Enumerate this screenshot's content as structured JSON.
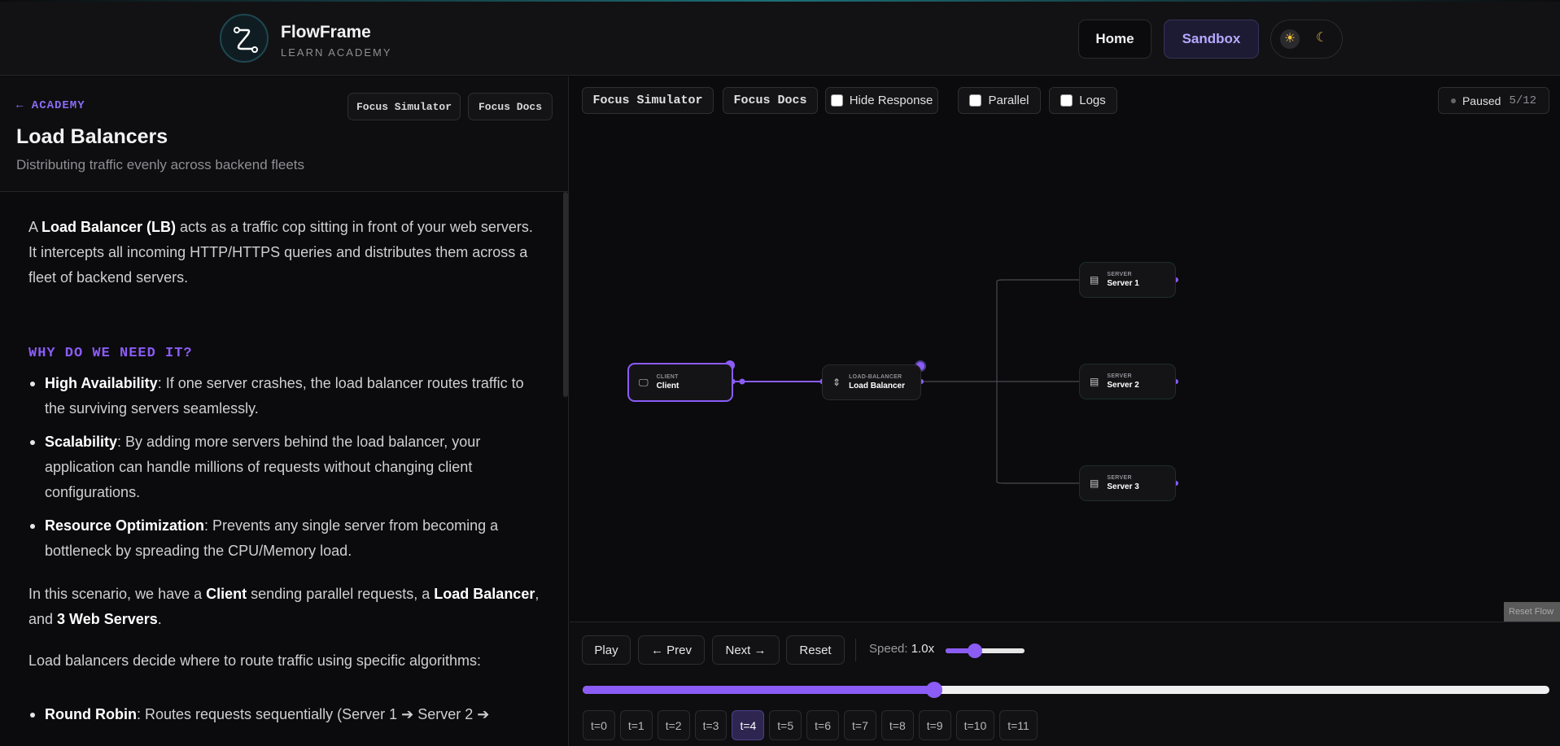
{
  "app": {
    "name": "FlowFrame",
    "tagline": "LEARN ACADEMY"
  },
  "nav": {
    "home": "Home",
    "sandbox": "Sandbox"
  },
  "theme": {
    "light_icon": "sun-icon",
    "dark_icon": "moon-icon"
  },
  "doc": {
    "back": "← ACADEMY",
    "focus_sim": "Focus Simulator",
    "focus_docs": "Focus Docs",
    "title": "Load Balancers",
    "subtitle": "Distributing traffic evenly across backend fleets",
    "intro_1": "A ",
    "intro_bold": "Load Balancer (LB)",
    "intro_2": " acts as a traffic cop sitting in front of your web servers. It intercepts all incoming HTTP/HTTPS queries and distributes them across a fleet of backend servers.",
    "why_heading": "WHY DO WE NEED IT?",
    "bullets": [
      {
        "bold": "High Availability",
        "text": ": If one server crashes, the load balancer routes traffic to the surviving servers seamlessly."
      },
      {
        "bold": "Scalability",
        "text": ": By adding more servers behind the load balancer, your application can handle millions of requests without changing client configurations."
      },
      {
        "bold": "Resource Optimization",
        "text": ": Prevents any single server from becoming a bottleneck by spreading the CPU/Memory load."
      }
    ],
    "scenario": {
      "t1": "In this scenario, we have a ",
      "b1": "Client",
      "t2": " sending parallel requests, a ",
      "b2": "Load Balancer",
      "t3": ", and ",
      "b3": "3 Web Servers",
      "t4": "."
    },
    "algo_intro": "Load balancers decide where to route traffic using specific algorithms:",
    "algo_bullet": {
      "bold": "Round Robin",
      "text": ": Routes requests sequentially (Server 1 ➔ Server 2 ➔"
    }
  },
  "sim": {
    "focus_sim": "Focus Simulator",
    "focus_docs": "Focus Docs",
    "hide_response": "Hide Response",
    "parallel": "Parallel",
    "logs": "Logs",
    "status": "Paused",
    "counter": "5/12",
    "nodes": {
      "client": {
        "kind": "CLIENT",
        "name": "Client"
      },
      "lb": {
        "kind": "LOAD-BALANCER",
        "name": "Load Balancer"
      },
      "s1": {
        "kind": "SERVER",
        "name": "Server 1"
      },
      "s2": {
        "kind": "SERVER",
        "name": "Server 2"
      },
      "s3": {
        "kind": "SERVER",
        "name": "Server 3"
      }
    },
    "reset_flow": "Reset Flow"
  },
  "controls": {
    "play": "Play",
    "prev": "← Prev",
    "next": "Next →",
    "reset": "Reset",
    "speed_label": "Speed:",
    "speed_value": "1.0x",
    "speed_fraction": 0.37,
    "timeline_fraction": 0.364,
    "steps": [
      "t=0",
      "t=1",
      "t=2",
      "t=3",
      "t=4",
      "t=5",
      "t=6",
      "t=7",
      "t=8",
      "t=9",
      "t=10",
      "t=11"
    ],
    "active_step": "t=4"
  },
  "colors": {
    "accent": "#8b5cf6",
    "background": "#0b0b0d"
  }
}
